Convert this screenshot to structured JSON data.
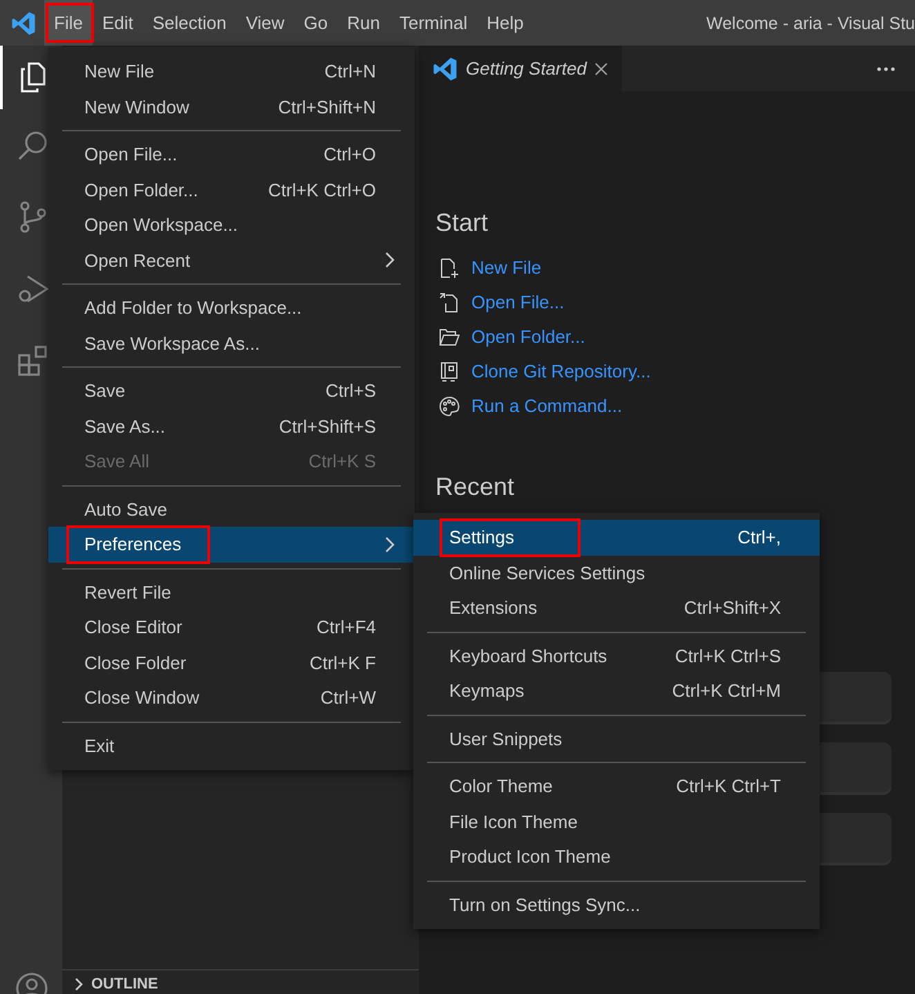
{
  "title_bar": {
    "menus": [
      {
        "label": "File",
        "selected": true,
        "highlighted": true
      },
      {
        "label": "Edit",
        "selected": false,
        "highlighted": false
      },
      {
        "label": "Selection",
        "selected": false,
        "highlighted": false
      },
      {
        "label": "View",
        "selected": false,
        "highlighted": false
      },
      {
        "label": "Go",
        "selected": false,
        "highlighted": false
      },
      {
        "label": "Run",
        "selected": false,
        "highlighted": false
      },
      {
        "label": "Terminal",
        "selected": false,
        "highlighted": false
      },
      {
        "label": "Help",
        "selected": false,
        "highlighted": false
      }
    ],
    "title": "Welcome - aria - Visual Stu"
  },
  "activity_bar": {
    "items": [
      {
        "kind": "explorer",
        "selected": true
      },
      {
        "kind": "search",
        "selected": false
      },
      {
        "kind": "source-control",
        "selected": false
      },
      {
        "kind": "run",
        "selected": false
      },
      {
        "kind": "extensions",
        "selected": false
      }
    ]
  },
  "editor": {
    "tabs": [
      {
        "label": "Getting Started",
        "selected": true
      }
    ]
  },
  "welcome": {
    "start_heading": "Start",
    "start_links": [
      {
        "kind": "new-file",
        "label": "New File"
      },
      {
        "kind": "open-file",
        "label": "Open File..."
      },
      {
        "kind": "open-folder",
        "label": "Open Folder..."
      },
      {
        "kind": "clone",
        "label": "Clone Git Repository..."
      },
      {
        "kind": "command",
        "label": "Run a Command..."
      }
    ],
    "recent_heading": "Recent"
  },
  "sidebar": {
    "sections": [
      {
        "label": "OUTLINE",
        "expanded": false
      }
    ]
  },
  "file_menu": {
    "groups": [
      [
        {
          "label": "New File",
          "shortcut": "Ctrl+N",
          "submenu": false,
          "disabled": false,
          "selected": false,
          "highlighted": false
        },
        {
          "label": "New Window",
          "shortcut": "Ctrl+Shift+N",
          "submenu": false,
          "disabled": false,
          "selected": false,
          "highlighted": false
        }
      ],
      [
        {
          "label": "Open File...",
          "shortcut": "Ctrl+O",
          "submenu": false,
          "disabled": false,
          "selected": false,
          "highlighted": false
        },
        {
          "label": "Open Folder...",
          "shortcut": "Ctrl+K Ctrl+O",
          "submenu": false,
          "disabled": false,
          "selected": false,
          "highlighted": false
        },
        {
          "label": "Open Workspace...",
          "submenu": false,
          "disabled": false,
          "selected": false,
          "highlighted": false
        },
        {
          "label": "Open Recent",
          "submenu": true,
          "disabled": false,
          "selected": false,
          "highlighted": false
        }
      ],
      [
        {
          "label": "Add Folder to Workspace...",
          "submenu": false,
          "disabled": false,
          "selected": false,
          "highlighted": false
        },
        {
          "label": "Save Workspace As...",
          "submenu": false,
          "disabled": false,
          "selected": false,
          "highlighted": false
        }
      ],
      [
        {
          "label": "Save",
          "shortcut": "Ctrl+S",
          "submenu": false,
          "disabled": false,
          "selected": false,
          "highlighted": false
        },
        {
          "label": "Save As...",
          "shortcut": "Ctrl+Shift+S",
          "submenu": false,
          "disabled": false,
          "selected": false,
          "highlighted": false
        },
        {
          "label": "Save All",
          "shortcut": "Ctrl+K S",
          "submenu": false,
          "disabled": true,
          "selected": false,
          "highlighted": false
        }
      ],
      [
        {
          "label": "Auto Save",
          "submenu": false,
          "disabled": false,
          "selected": false,
          "highlighted": false
        },
        {
          "label": "Preferences",
          "submenu": true,
          "disabled": false,
          "selected": true,
          "highlighted": true
        }
      ],
      [
        {
          "label": "Revert File",
          "submenu": false,
          "disabled": false,
          "selected": false,
          "highlighted": false
        },
        {
          "label": "Close Editor",
          "shortcut": "Ctrl+F4",
          "submenu": false,
          "disabled": false,
          "selected": false,
          "highlighted": false
        },
        {
          "label": "Close Folder",
          "shortcut": "Ctrl+K F",
          "submenu": false,
          "disabled": false,
          "selected": false,
          "highlighted": false
        },
        {
          "label": "Close Window",
          "shortcut": "Ctrl+W",
          "submenu": false,
          "disabled": false,
          "selected": false,
          "highlighted": false
        }
      ],
      [
        {
          "label": "Exit",
          "submenu": false,
          "disabled": false,
          "selected": false,
          "highlighted": false
        }
      ]
    ]
  },
  "preferences_submenu": {
    "groups": [
      [
        {
          "label": "Settings",
          "shortcut": "Ctrl+,",
          "submenu": false,
          "disabled": false,
          "selected": true,
          "highlighted": true
        },
        {
          "label": "Online Services Settings",
          "submenu": false,
          "disabled": false,
          "selected": false,
          "highlighted": false
        },
        {
          "label": "Extensions",
          "shortcut": "Ctrl+Shift+X",
          "submenu": false,
          "disabled": false,
          "selected": false,
          "highlighted": false
        }
      ],
      [
        {
          "label": "Keyboard Shortcuts",
          "shortcut": "Ctrl+K Ctrl+S",
          "submenu": false,
          "disabled": false,
          "selected": false,
          "highlighted": false
        },
        {
          "label": "Keymaps",
          "shortcut": "Ctrl+K Ctrl+M",
          "submenu": false,
          "disabled": false,
          "selected": false,
          "highlighted": false
        }
      ],
      [
        {
          "label": "User Snippets",
          "submenu": false,
          "disabled": false,
          "selected": false,
          "highlighted": false
        }
      ],
      [
        {
          "label": "Color Theme",
          "shortcut": "Ctrl+K Ctrl+T",
          "submenu": false,
          "disabled": false,
          "selected": false,
          "highlighted": false
        },
        {
          "label": "File Icon Theme",
          "submenu": false,
          "disabled": false,
          "selected": false,
          "highlighted": false
        },
        {
          "label": "Product Icon Theme",
          "submenu": false,
          "disabled": false,
          "selected": false,
          "highlighted": false
        }
      ],
      [
        {
          "label": "Turn on Settings Sync...",
          "submenu": false,
          "disabled": false,
          "selected": false,
          "highlighted": false
        }
      ]
    ]
  }
}
